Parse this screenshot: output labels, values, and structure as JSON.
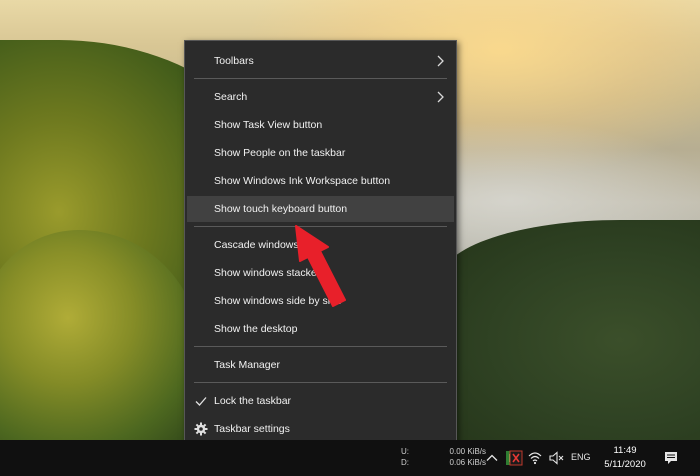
{
  "context_menu": {
    "items": [
      {
        "label": "Toolbars",
        "submenu": true
      },
      {
        "label": "Search",
        "submenu": true
      },
      {
        "label": "Show Task View button"
      },
      {
        "label": "Show People on the taskbar"
      },
      {
        "label": "Show Windows Ink Workspace button"
      },
      {
        "label": "Show touch keyboard button",
        "highlighted": true
      },
      {
        "label": "Cascade windows"
      },
      {
        "label": "Show windows stacked"
      },
      {
        "label": "Show windows side by side"
      },
      {
        "label": "Show the desktop"
      },
      {
        "label": "Task Manager"
      },
      {
        "label": "Lock the taskbar",
        "checked": true
      },
      {
        "label": "Taskbar settings",
        "icon": "gear-icon"
      }
    ]
  },
  "taskbar": {
    "net_upload_label": "U:",
    "net_upload_value": "0.00 KiB/s",
    "net_download_label": "D:",
    "net_download_value": "0.06 KiB/s",
    "language": "ENG",
    "time": "11:49",
    "date": "5/11/2020",
    "tray_icons": [
      "chevron-up-icon",
      "app-green-icon",
      "app-red-icon",
      "wifi-icon",
      "volume-muted-icon",
      "notification-icon"
    ]
  },
  "colors": {
    "menu_bg": "#2b2b2b",
    "menu_highlight": "#414141",
    "menu_text": "#f2f2f2",
    "taskbar_bg": "#101010",
    "annotation_arrow": "#e8202a"
  }
}
